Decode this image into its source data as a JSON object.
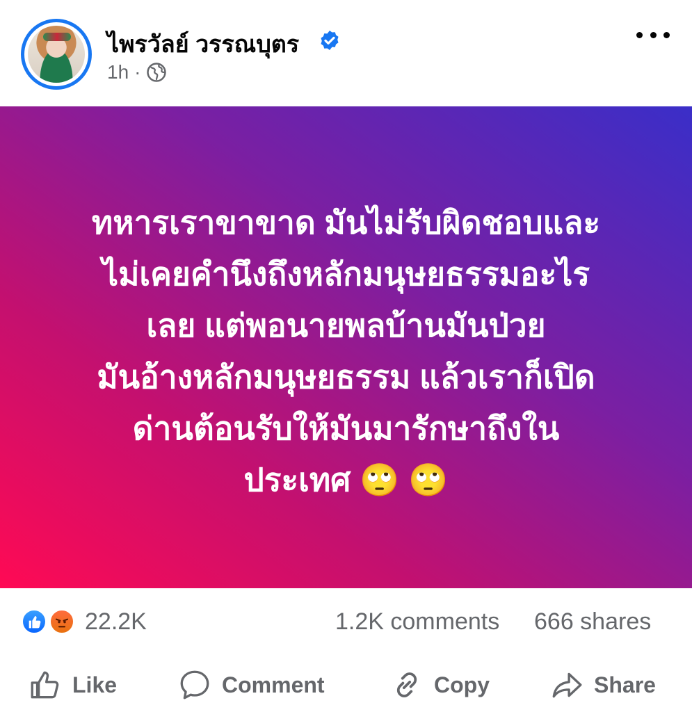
{
  "author": {
    "name": "ไพรวัลย์ วรรณบุตร",
    "timestamp": "1h",
    "separator": "·",
    "verified_icon": "verified-badge-icon",
    "privacy_icon": "globe-icon"
  },
  "post": {
    "lines": [
      "ทหารเราขาขาด มันไม่รับผิดชอบและ",
      "ไม่เคยคำนึงถึงหลักมนุษยธรรมอะไร",
      "เลย  แต่พอนายพลบ้านมันป่วย",
      "มันอ้างหลักมนุษยธรรม  แล้วเราก็เปิด",
      "ด่านต้อนรับให้มันมารักษาถึงใน",
      "ประเทศ 🙄 🙄"
    ],
    "background_colors": [
      "#ff0a54",
      "#7b1fa2",
      "#3a2ec8"
    ]
  },
  "stats": {
    "reactions": "22.2K",
    "comments": "1.2K comments",
    "shares": "666 shares",
    "reaction_icons": [
      "like-reaction-icon",
      "angry-reaction-icon"
    ]
  },
  "actions": {
    "like": "Like",
    "comment": "Comment",
    "copy": "Copy",
    "share": "Share"
  },
  "colors": {
    "accent": "#1877f2",
    "muted_text": "#65676b"
  }
}
